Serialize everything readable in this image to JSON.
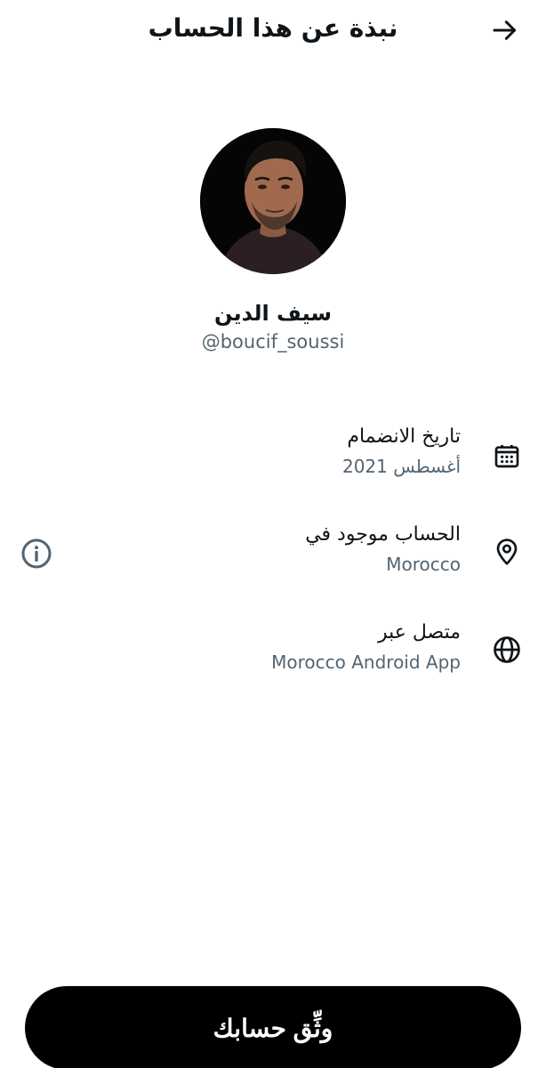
{
  "header": {
    "title": "نبذة عن هذا الحساب",
    "back_icon": "arrow-right-icon"
  },
  "profile": {
    "display_name": "سيف الدين",
    "handle": "@boucif_soussi",
    "avatar_icon": "profile-photo"
  },
  "info_rows": [
    {
      "label": "تاريخ الانضمام",
      "value": "أغسطس 2021",
      "icon": "calendar-icon"
    },
    {
      "label": "الحساب موجود في",
      "value": "Morocco",
      "icon": "location-pin-icon"
    },
    {
      "label": "متصل عبر",
      "value": "Morocco Android App",
      "icon": "globe-icon"
    }
  ],
  "about_info_icon": "info-icon",
  "verify_button": {
    "label": "وثِّق حسابك"
  },
  "colors": {
    "primary_text": "#0f1419",
    "secondary_text": "#536471",
    "button_bg": "#000000",
    "button_text": "#ffffff",
    "background": "#ffffff"
  }
}
